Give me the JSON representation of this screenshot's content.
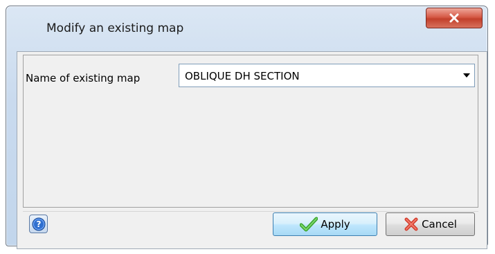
{
  "window": {
    "title": "Modify an existing map",
    "close_icon": "close-icon"
  },
  "form": {
    "map_label": "Name of existing map",
    "map_selected": "OBLIQUE DH SECTION"
  },
  "footer": {
    "help_icon": "help-icon",
    "apply_label": "Apply",
    "cancel_label": "Cancel"
  },
  "colors": {
    "close_red": "#c2402c",
    "apply_check_green": "#3aa52c",
    "cancel_x_red": "#d23a2a",
    "help_blue": "#2f6fcf"
  }
}
